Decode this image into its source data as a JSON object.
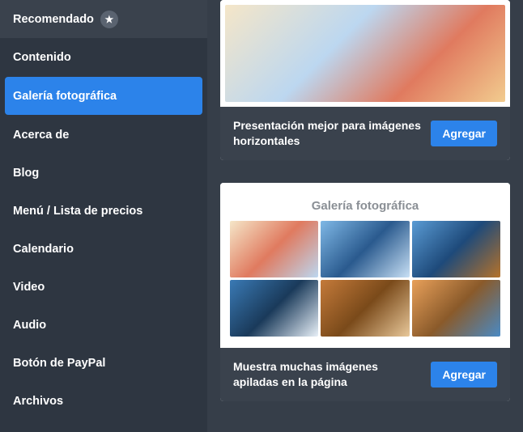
{
  "sidebar": {
    "items": [
      {
        "label": "Recomendado",
        "star": true,
        "active": false
      },
      {
        "label": "Contenido",
        "star": false,
        "active": false
      },
      {
        "label": "Galería fotográfica",
        "star": false,
        "active": true
      },
      {
        "label": "Acerca de",
        "star": false,
        "active": false
      },
      {
        "label": "Blog",
        "star": false,
        "active": false
      },
      {
        "label": "Menú / Lista de precios",
        "star": false,
        "active": false
      },
      {
        "label": "Calendario",
        "star": false,
        "active": false
      },
      {
        "label": "Video",
        "star": false,
        "active": false
      },
      {
        "label": "Audio",
        "star": false,
        "active": false
      },
      {
        "label": "Botón de PayPal",
        "star": false,
        "active": false
      },
      {
        "label": "Archivos",
        "star": false,
        "active": false
      }
    ]
  },
  "cards": [
    {
      "description": "Presentación mejor para imágenes horizontales",
      "button": "Agregar",
      "kind": "single"
    },
    {
      "title": "Galería fotográfica",
      "description": "Muestra muchas imágenes apiladas en la página",
      "button": "Agregar",
      "kind": "grid"
    }
  ]
}
